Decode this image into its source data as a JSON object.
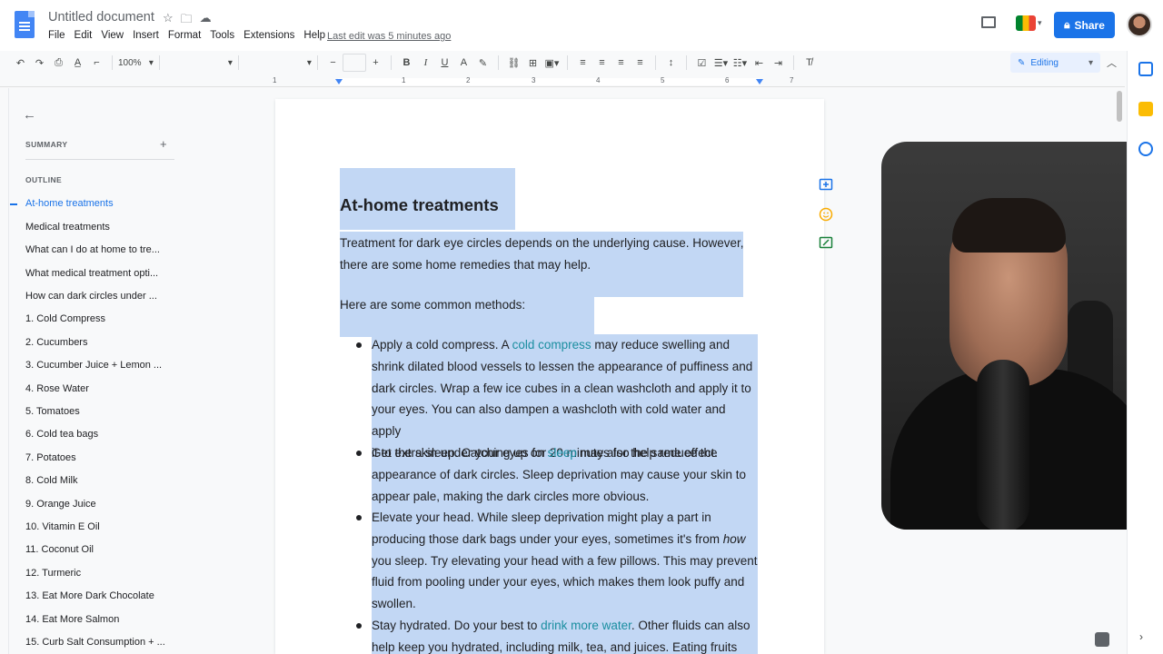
{
  "title_bar": {
    "doc_title": "Untitled document",
    "menu": [
      "File",
      "Edit",
      "View",
      "Insert",
      "Format",
      "Tools",
      "Extensions",
      "Help"
    ],
    "last_edit": "Last edit was 5 minutes ago",
    "share_label": "Share"
  },
  "toolbar": {
    "zoom": "100%",
    "font_size": "",
    "mode": "Editing"
  },
  "ruler": {
    "marks": [
      "1",
      "1",
      "2",
      "3",
      "4",
      "5",
      "6",
      "7"
    ]
  },
  "outline_panel": {
    "summary_label": "SUMMARY",
    "outline_label": "OUTLINE",
    "items": [
      "At-home treatments",
      "Medical treatments",
      "What can I do at home to tre...",
      "What medical treatment opti...",
      "How can dark circles under ...",
      "1. Cold Compress",
      "2. Cucumbers",
      "3. Cucumber Juice + Lemon ...",
      "4. Rose Water",
      "5. Tomatoes",
      "6. Cold tea bags",
      "7. Potatoes",
      "8. Cold Milk",
      "9. Orange Juice",
      "10. Vitamin E Oil",
      "11. Coconut Oil",
      "12. Turmeric",
      "13. Eat More Dark Chocolate",
      "14. Eat More Salmon",
      "15. Curb Salt Consumption + ..."
    ]
  },
  "document": {
    "heading": "At-home treatments",
    "intro_1": "Treatment for dark eye circles depends on the underlying cause. However,",
    "intro_2": "there are some home remedies that may help.",
    "methods_intro": "Here are some common methods:",
    "bullet_1": {
      "before": "Apply a cold compress. A ",
      "link": "cold compress",
      "after_first_line": " may reduce swelling and",
      "rest": [
        "shrink dilated blood vessels to lessen the appearance of puffiness and",
        "dark circles. Wrap a few ice cubes in a clean washcloth and apply it to",
        "your eyes. You can also dampen a washcloth with cold water and apply",
        "it to the skin under your eyes for 20 minutes for the same effect."
      ]
    },
    "bullet_2": {
      "before": "Get extra sleep. Catching up on ",
      "link": "sleep",
      "after_first_line": " may also help reduce the",
      "rest": [
        "appearance of dark circles. Sleep deprivation may cause your skin to",
        "appear pale, making the dark circles more obvious."
      ]
    },
    "bullet_3": {
      "line_1": "Elevate your head. While sleep deprivation might play a part in",
      "line_2_before": "producing those dark bags under your eyes, sometimes it's from ",
      "line_2_italic": "how",
      "rest": [
        "you sleep. Try elevating your head with a few pillows. This may prevent",
        "fluid from pooling under your eyes, which makes them look puffy and",
        "swollen."
      ]
    },
    "bullet_4": {
      "before": "Stay hydrated. Do your best to ",
      "link": "drink more water",
      "after_first_line": ". Other fluids can also",
      "line_2": "help keep you hydrated, including milk, tea, and juices. Eating fruits and"
    }
  },
  "colors": {
    "accent": "#1a73e8",
    "selection": "#c2d7f4",
    "link": "#1a8ea0"
  }
}
